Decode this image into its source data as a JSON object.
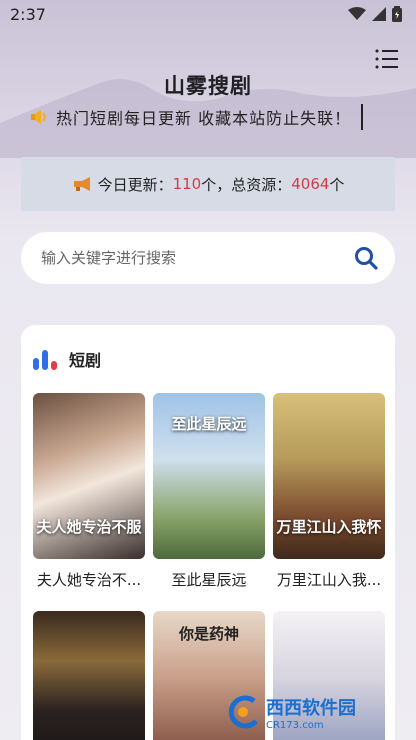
{
  "status_bar": {
    "time": "2:37"
  },
  "header": {
    "title": "山雾搜剧"
  },
  "marquee": {
    "text": "热门短剧每日更新 收藏本站防止失联！"
  },
  "stats": {
    "prefix": "今日更新：",
    "today_count": "110",
    "mid": "个，总资源：",
    "total_count": "4064",
    "suffix": "个"
  },
  "search": {
    "placeholder": "输入关键字进行搜索"
  },
  "section": {
    "title": "短剧",
    "items": [
      {
        "label": "夫人她专治不...",
        "poster_text": "夫人她专治不服"
      },
      {
        "label": "至此星辰远",
        "poster_text": "至此星辰远"
      },
      {
        "label": "万里江山入我...",
        "poster_text": "万里江山入我怀"
      },
      {
        "poster_text": ""
      },
      {
        "poster_text": "你是药神"
      },
      {
        "poster_text": ""
      }
    ]
  },
  "watermark": {
    "text": "西西软件园",
    "sub": "CR173.com"
  },
  "colors": {
    "accent_red": "#d33a4a",
    "search_blue": "#1f4fa8",
    "chart_icon_blue": "#2f6ee5",
    "chart_icon_red": "#e53a4a"
  }
}
